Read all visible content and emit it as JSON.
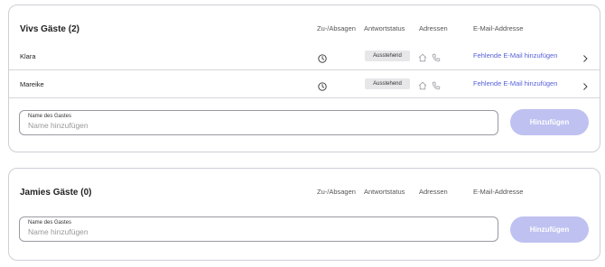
{
  "columns": {
    "rsvp": "Zu-/Absagen",
    "response_status": "Antwortstatus",
    "addresses": "Adressen",
    "email": "E-Mail-Addresse"
  },
  "groups": [
    {
      "title": "Vivs Gäste (2)",
      "guests": [
        {
          "name": "Klara",
          "status": "Ausstehend",
          "email_action": "Fehlende E-Mail hinzufügen"
        },
        {
          "name": "Mareike",
          "status": "Ausstehend",
          "email_action": "Fehlende E-Mail hinzufügen"
        }
      ],
      "input_label": "Name des Gastes",
      "input_placeholder": "Name hinzufügen",
      "add_button": "Hinzufügen"
    },
    {
      "title": "Jamies Gäste (0)",
      "guests": [],
      "input_label": "Name des Gastes",
      "input_placeholder": "Name hinzufügen",
      "add_button": "Hinzufügen"
    }
  ],
  "colors": {
    "accent_link": "#5660d9",
    "button_disabled": "#bfc1f0",
    "badge_bg": "#e7e7ea"
  },
  "icons": [
    "clock-icon",
    "home-icon",
    "phone-icon",
    "chevron-right-icon"
  ]
}
